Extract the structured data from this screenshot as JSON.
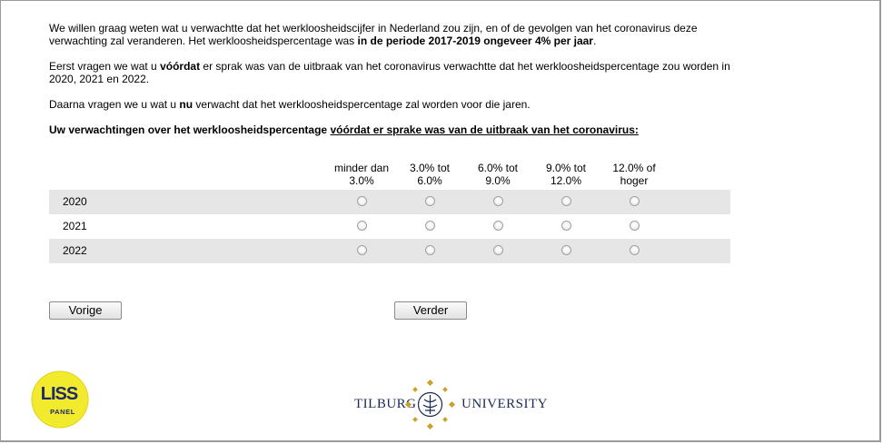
{
  "intro": {
    "p1_text": "We willen graag weten wat u verwachtte dat het werkloosheidscijfer in Nederland zou zijn, en of de gevolgen van het coronavirus deze verwachting zal veranderen. Het werkloosheidspercentage was ",
    "p1_bold": "in de periode 2017-2019 ongeveer 4% per jaar",
    "p1_end": ".",
    "p2_a": "Eerst vragen we wat u ",
    "p2_bold": "vóórdat",
    "p2_b": " er sprak was van de uitbraak van het coronavirus verwachtte dat het werkloosheidspercentage zou worden in 2020, 2021 en 2022.",
    "p3_a": "Daarna vragen we u wat u ",
    "p3_bold": "nu",
    "p3_b": " verwacht dat het werkloosheidspercentage zal worden voor die jaren.",
    "heading_a": "Uw verwachtingen over het werkloosheidspercentage ",
    "heading_u": "vóórdat er sprake was van de uitbraak van het coronavirus:"
  },
  "grid": {
    "columns": [
      {
        "line1": "minder dan",
        "line2": "3.0%"
      },
      {
        "line1": "3.0% tot",
        "line2": "6.0%"
      },
      {
        "line1": "6.0% tot",
        "line2": "9.0%"
      },
      {
        "line1": "9.0% tot",
        "line2": "12.0%"
      },
      {
        "line1": "12.0% of",
        "line2": "hoger"
      }
    ],
    "rows": [
      "2020",
      "2021",
      "2022"
    ]
  },
  "buttons": {
    "back": "Vorige",
    "next": "Verder"
  },
  "logos": {
    "liss_top": "LISS",
    "liss_bottom": "PANEL",
    "tilburg_left": "TILBURG",
    "tilburg_right": "UNIVERSITY"
  },
  "colors": {
    "row_shade": "#e6e6e6",
    "liss_yellow": "#f2ea2c",
    "tilburg_gold": "#c9a227",
    "tilburg_blue": "#1a2a55"
  }
}
